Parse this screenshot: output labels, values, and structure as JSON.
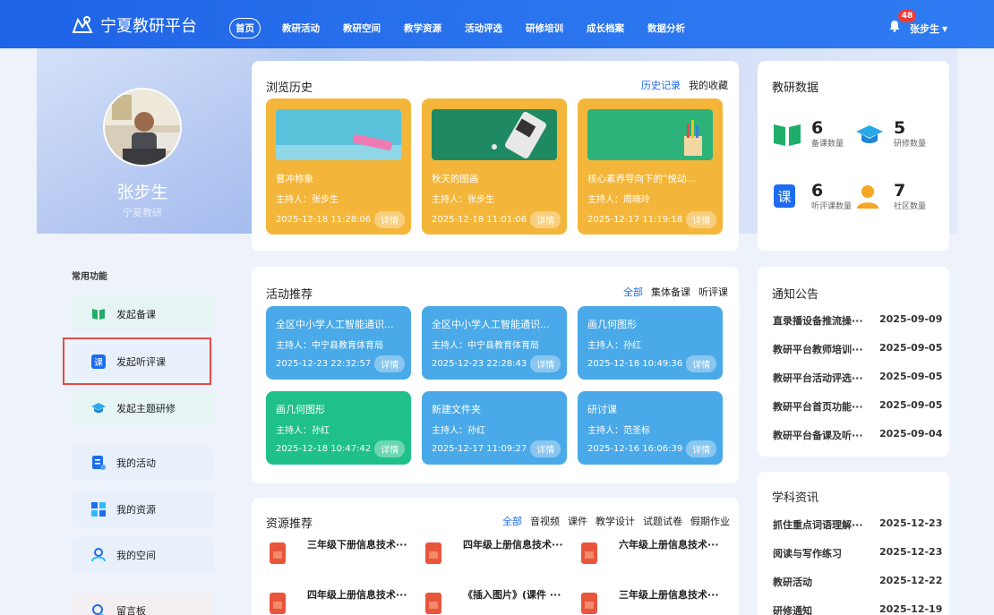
{
  "app": {
    "title": "宁夏教研平台"
  },
  "nav": {
    "items": [
      "首页",
      "教研活动",
      "教研空间",
      "教学资源",
      "活动评选",
      "研修培训",
      "成长档案",
      "数据分析"
    ]
  },
  "user": {
    "notifications": "48",
    "name": "张步生",
    "org": "宁夏教研"
  },
  "history": {
    "title": "浏览历史",
    "links": [
      "历史记录",
      "我的收藏"
    ],
    "cards": [
      {
        "title": "曹冲称象",
        "host": "主持人：张步生",
        "date": "2025-12-18 11:28:06",
        "btn": "详情"
      },
      {
        "title": "秋天的图画",
        "host": "主持人：张步生",
        "date": "2025-12-18 11:01:06",
        "btn": "详情"
      },
      {
        "title": "核心素养导向下的“悦动...",
        "host": "主持人：周晓玲",
        "date": "2025-12-17 11:19:18",
        "btn": "详情"
      }
    ]
  },
  "stats": {
    "title": "教研数据",
    "items": [
      {
        "num": "6",
        "label": "备课数量",
        "icon": "book-icon"
      },
      {
        "num": "5",
        "label": "研修数量",
        "icon": "graduation-cap-icon"
      },
      {
        "num": "6",
        "label": "听评课数量",
        "icon": "lesson-icon"
      },
      {
        "num": "7",
        "label": "社区数量",
        "icon": "person-icon"
      }
    ]
  },
  "functions": {
    "title": "常用功能",
    "items": [
      {
        "label": "发起备课",
        "icon": "book-icon"
      },
      {
        "label": "发起听评课",
        "icon": "lesson-icon"
      },
      {
        "label": "发起主题研修",
        "icon": "graduation-cap-icon"
      },
      {
        "label": "我的活动",
        "icon": "document-icon"
      },
      {
        "label": "我的资源",
        "icon": "grid-icon"
      },
      {
        "label": "我的空间",
        "icon": "user-icon"
      },
      {
        "label": "留言板",
        "icon": "message-icon"
      }
    ]
  },
  "activities": {
    "title": "活动推荐",
    "links": [
      "全部",
      "集体备课",
      "听评课"
    ],
    "cards": [
      {
        "title": "全区中小学人工智能通识...",
        "host": "主持人：中宁县教育体育局",
        "date": "2025-12-23 22:32:57",
        "btn": "详情"
      },
      {
        "title": "全区中小学人工智能通识...",
        "host": "主持人：中宁县教育体育局",
        "date": "2025-12-23 22:28:43",
        "btn": "详情"
      },
      {
        "title": "画几何图形",
        "host": "主持人：孙红",
        "date": "2025-12-18 10:49:36",
        "btn": "详情"
      },
      {
        "title": "画几何图形",
        "host": "主持人：孙红",
        "date": "2025-12-18 10:47:42",
        "btn": "详情"
      },
      {
        "title": "新建文件夹",
        "host": "主持人：孙红",
        "date": "2025-12-17 11:09:27",
        "btn": "详情"
      },
      {
        "title": "研讨课",
        "host": "主持人：范圣标",
        "date": "2025-12-16 16:06:39",
        "btn": "详情"
      }
    ]
  },
  "resources": {
    "title": "资源推荐",
    "links": [
      "全部",
      "音视频",
      "课件",
      "教学设计",
      "试题试卷",
      "假期作业"
    ],
    "items": [
      "三年级下册信息技术···",
      "四年级上册信息技术···",
      "六年级上册信息技术···",
      "四年级上册信息技术···",
      "《插入图片》(课件 ···",
      "三年级上册信息技术···"
    ]
  },
  "notices": {
    "title": "通知公告",
    "items": [
      {
        "title": "直录播设备推流操···",
        "date": "2025-09-09"
      },
      {
        "title": "教研平台教师培训···",
        "date": "2025-09-05"
      },
      {
        "title": "教研平台活动评选···",
        "date": "2025-09-05"
      },
      {
        "title": "教研平台首页功能···",
        "date": "2025-09-05"
      },
      {
        "title": "教研平台备课及听···",
        "date": "2025-09-04"
      }
    ]
  },
  "news": {
    "title": "学科资讯",
    "items": [
      {
        "title": "抓住重点词语理解···",
        "date": "2025-12-23"
      },
      {
        "title": "阅读与写作练习",
        "date": "2025-12-23"
      },
      {
        "title": "教研活动",
        "date": "2025-12-22"
      },
      {
        "title": "研修通知",
        "date": "2025-12-19"
      }
    ]
  }
}
